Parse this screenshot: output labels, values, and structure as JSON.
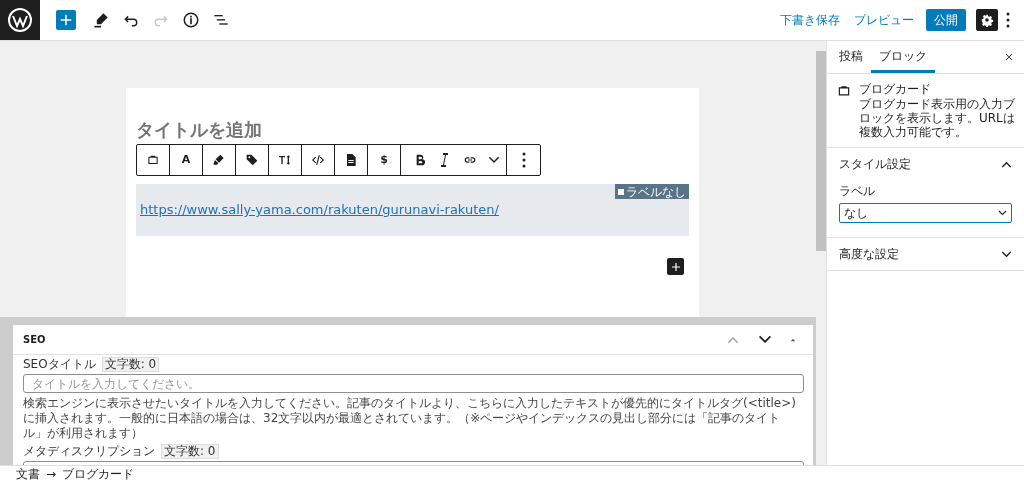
{
  "topbar": {
    "tools": [
      {
        "kind": "add"
      },
      {
        "kind": "edit"
      },
      {
        "kind": "undo",
        "disabled": false
      },
      {
        "kind": "redo",
        "disabled": true
      },
      {
        "kind": "info"
      },
      {
        "kind": "list"
      }
    ],
    "save_draft": "下書き保存",
    "preview": "プレビュー",
    "publish": "公開",
    "settings_active": true
  },
  "editor": {
    "title_placeholder": "タイトルを追加",
    "block_toolbar": [
      {
        "kind": "card"
      },
      {
        "kind": "text",
        "label": "A"
      },
      {
        "kind": "marker"
      },
      {
        "kind": "tag"
      },
      {
        "kind": "textsize"
      },
      {
        "kind": "code"
      },
      {
        "kind": "file"
      },
      {
        "kind": "text",
        "label": "$"
      },
      {
        "kind": "bold"
      },
      {
        "kind": "italic"
      },
      {
        "kind": "link"
      },
      {
        "kind": "chevron"
      },
      {
        "kind": "more"
      }
    ],
    "url": "https://www.sally-yama.com/rakuten/gurunavi-rakuten/",
    "label_badge": "ラベルなし"
  },
  "seo": {
    "title": "SEO",
    "fields": [
      {
        "label": "SEOタイトル",
        "count": "文字数: 0",
        "placeholder": "タイトルを入力してください。",
        "help": "検索エンジンに表示させたいタイトルを入力してください。記事のタイトルより、こちらに入力したテキストが優先的にタイトルタグ(<title>)に挿入されます。一般的に日本語の場合は、32文字以内が最適とされています。（※ページやインデックスの見出し部分には「記事のタイトル」が利用されます）"
      },
      {
        "label": "メタディスクリプション",
        "count": "文字数: 0"
      }
    ]
  },
  "breadcrumb": {
    "items": [
      "文書",
      "ブログカード"
    ],
    "separator": "→"
  },
  "sidebar": {
    "tabs": [
      {
        "label": "投稿",
        "selected": false
      },
      {
        "label": "ブロック",
        "selected": true
      }
    ],
    "block": {
      "name": "ブログカード",
      "description": "ブログカード表示用の入力ブロックを表示します。URLは複数入力可能です。"
    },
    "panels": [
      {
        "title": "スタイル設定",
        "expanded": true,
        "field_label": "ラベル",
        "value": "なし"
      },
      {
        "title": "高度な設定",
        "expanded": false
      }
    ]
  }
}
